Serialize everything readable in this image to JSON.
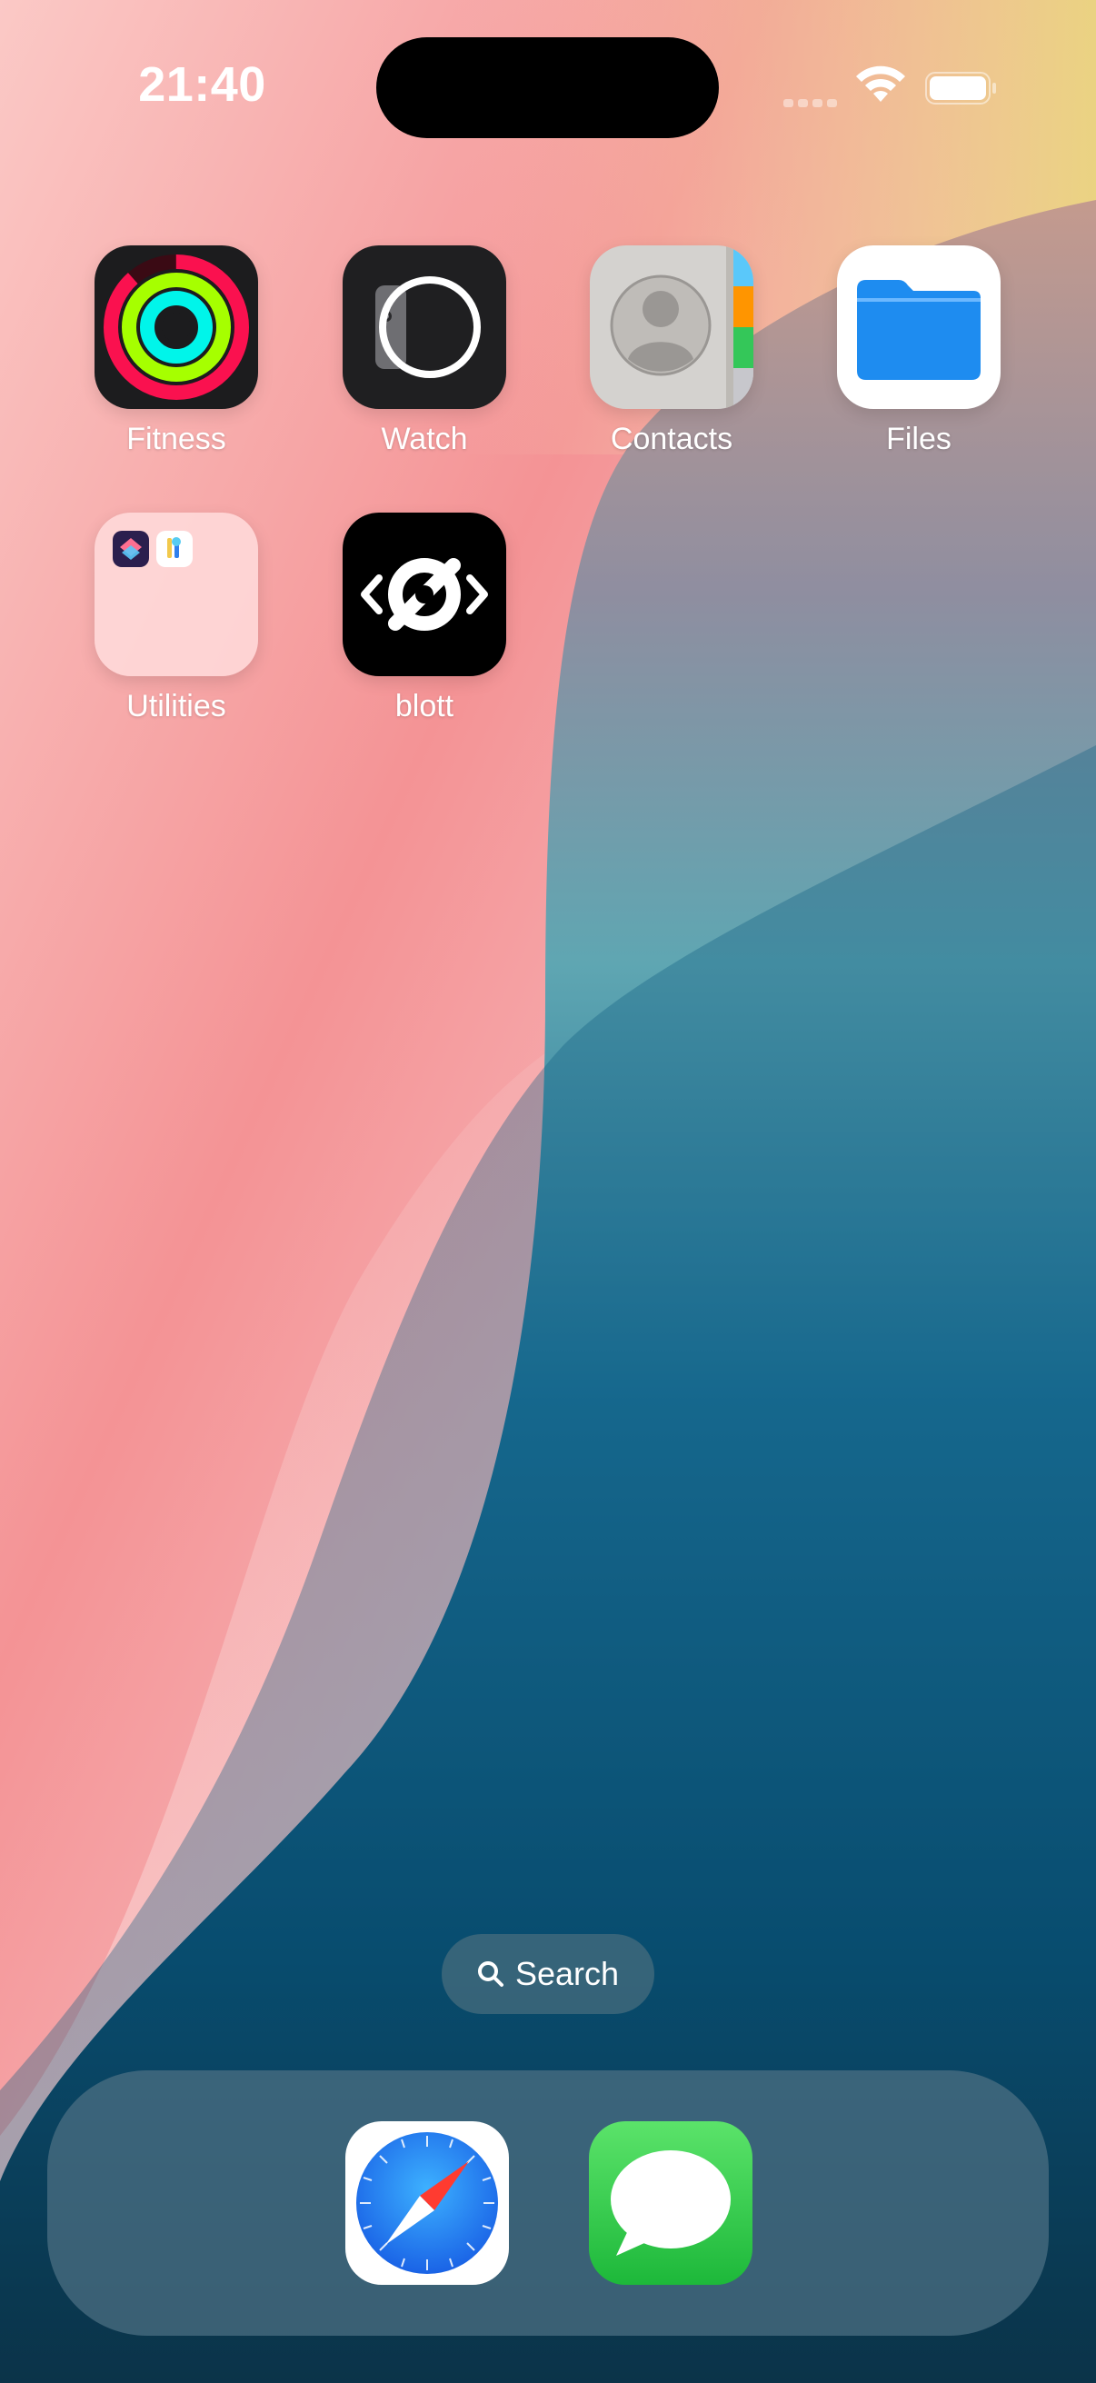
{
  "status_bar": {
    "time": "21:40",
    "wifi_icon": "wifi-icon",
    "battery_icon": "battery-icon",
    "cellular_icon": "cellular-signal-icon"
  },
  "home_apps": [
    {
      "label": "Fitness",
      "icon": "fitness-rings-icon"
    },
    {
      "label": "Watch",
      "icon": "watch-icon"
    },
    {
      "label": "Contacts",
      "icon": "contacts-icon"
    },
    {
      "label": "Files",
      "icon": "files-folder-icon"
    },
    {
      "label": "Utilities",
      "icon": "folder-icon"
    },
    {
      "label": "blott",
      "icon": "blott-icon"
    }
  ],
  "search": {
    "label": "Search",
    "icon": "search-icon"
  },
  "dock": {
    "apps": [
      {
        "name": "Safari",
        "icon": "safari-compass-icon"
      },
      {
        "name": "Messages",
        "icon": "messages-bubble-icon"
      }
    ]
  },
  "colors": {
    "fitness_move": "#fa114f",
    "fitness_exercise": "#a6ff00",
    "fitness_stand": "#00f5ea",
    "files_blue": "#1e8cf0",
    "messages_green": "#34c759",
    "safari_blue": "#1a7cf5"
  }
}
